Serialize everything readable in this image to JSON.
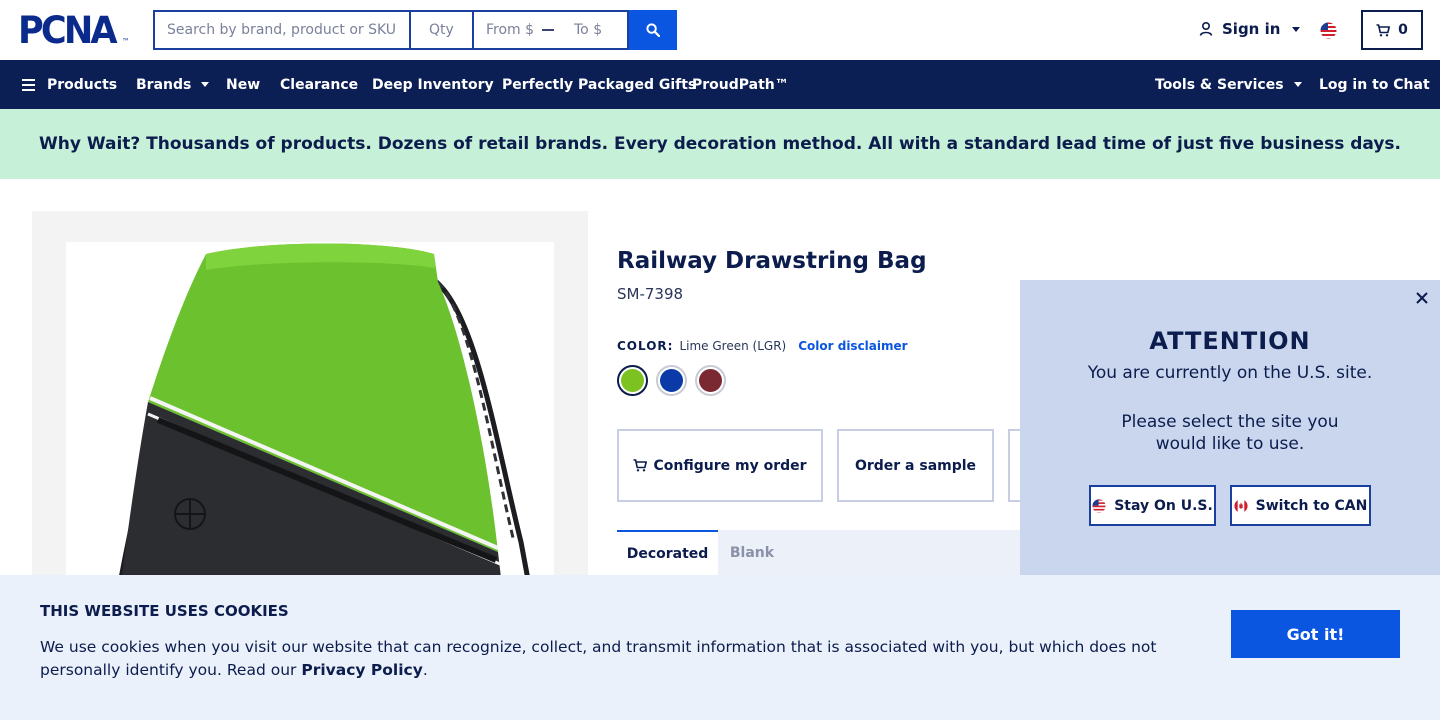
{
  "header": {
    "logo_text": "PCNA",
    "logo_tm": "™",
    "search_placeholder": "Search by brand, product or SKU",
    "qty_placeholder": "Qty",
    "from_placeholder": "From $",
    "to_placeholder": "To $",
    "signin_label": "Sign in",
    "cart_count": "0"
  },
  "nav": {
    "left": [
      "Products",
      "Brands",
      "New",
      "Clearance",
      "Deep Inventory",
      "Perfectly Packaged Gifts",
      "ProudPath™"
    ],
    "tools_label": "Tools & Services",
    "chat_label": "Log in to Chat"
  },
  "promo": {
    "text": "Why Wait? Thousands of products. Dozens of retail brands. Every decoration method. All with a standard lead time of just five business days."
  },
  "product": {
    "title": "Railway Drawstring Bag",
    "sku": "SM-7398",
    "color_label": "COLOR:",
    "color_value": "Lime Green (LGR)",
    "color_disclaimer": "Color disclaimer",
    "swatches": [
      "#7cc322",
      "#0a3aa8",
      "#7a2832"
    ],
    "configure_label": "Configure my order",
    "sample_label": "Order a sample",
    "tabs": [
      "Decorated",
      "Blank"
    ]
  },
  "attention": {
    "title": "ATTENTION",
    "line1": "You are currently on the U.S. site.",
    "line2": "Please select the site you",
    "line3": "would like to use.",
    "stay_label": "Stay On U.S.",
    "switch_label": "Switch to CAN"
  },
  "cookie": {
    "title": "THIS WEBSITE USES COOKIES",
    "text_before": "We use cookies when you visit our website that can recognize, collect, and transmit information that is associated with you, but which does not personally identify you. Read our ",
    "link": "Privacy Policy",
    "text_after": ".",
    "button": "Got it!"
  },
  "colors": {
    "navy": "#0c1f55",
    "accent": "#0a56e0",
    "promo_bg": "#c6f0d8",
    "bag_green": "#6cc12e",
    "bag_black": "#2b2d30"
  }
}
